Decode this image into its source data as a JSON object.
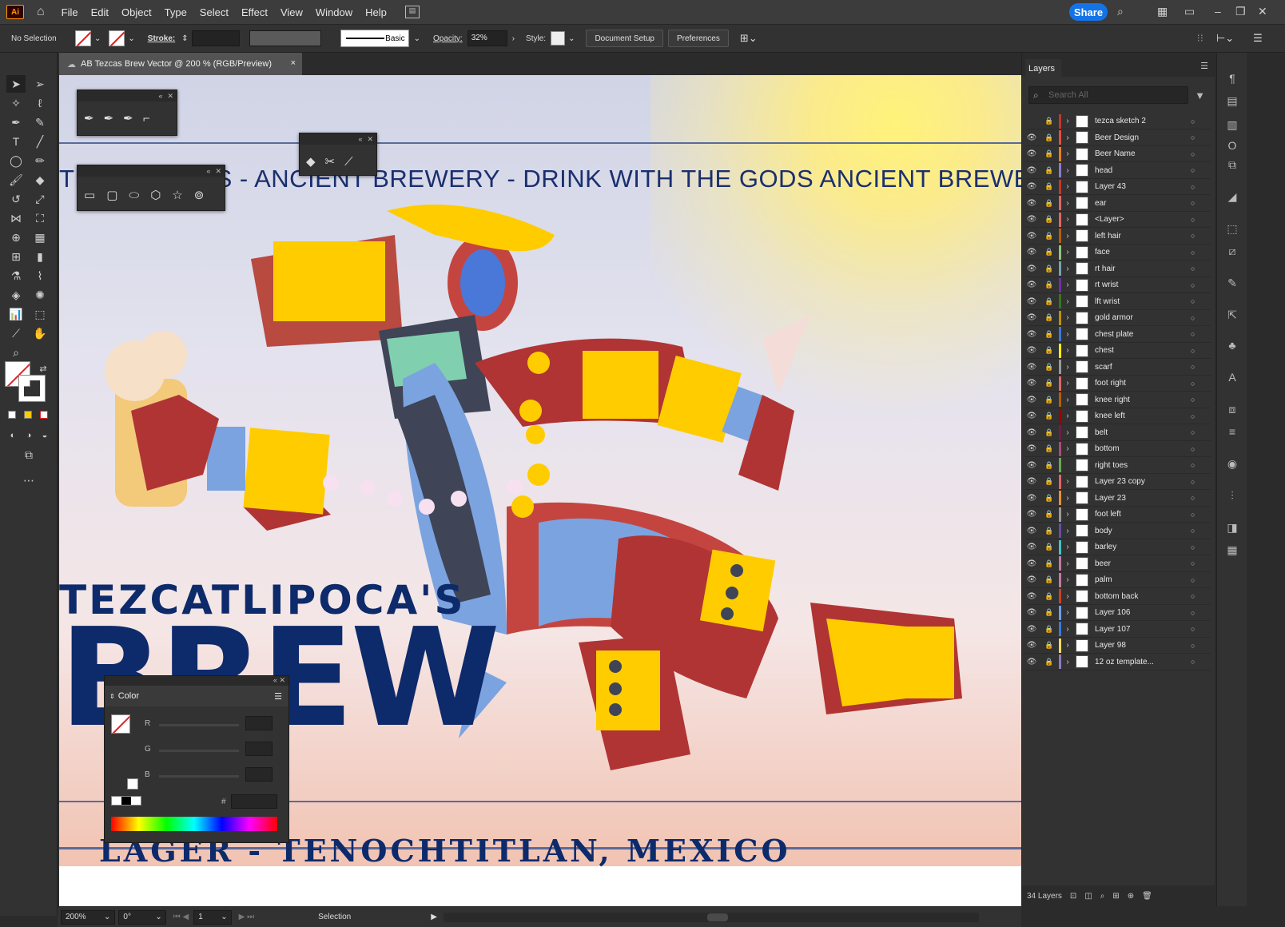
{
  "app": {
    "logo": "Ai"
  },
  "menu": [
    "File",
    "Edit",
    "Object",
    "Type",
    "Select",
    "Effect",
    "View",
    "Window",
    "Help"
  ],
  "share_label": "Share",
  "control": {
    "selection": "No Selection",
    "stroke_label": "Stroke:",
    "stroke_style": "Basic",
    "opacity_label": "Opacity:",
    "opacity_value": "32%",
    "style_label": "Style:",
    "document_setup": "Document Setup",
    "preferences": "Preferences"
  },
  "document_tab": {
    "title": "AB Tezcas Brew Vector @ 200 % (RGB/Preview)",
    "close": "×"
  },
  "artwork": {
    "band_text": "TH THE GODS - ANCIENT BREWERY - DRINK WITH THE GODS   ANCIENT BREWERY - DRINK WI",
    "title_line1": "TEZCATLIPOCA'S",
    "title_line2": "BREW",
    "subline": "LAGER - TENOCHTITLAN, MEXICO",
    "colors": {
      "navy": "#0d2a6b",
      "red": "#b03434",
      "yellow": "#ffcc00",
      "blue": "#7ba3e0"
    }
  },
  "color_panel": {
    "title": "Color",
    "r": "R",
    "g": "G",
    "b": "B",
    "hash": "#"
  },
  "layers_panel": {
    "title": "Layers",
    "search_placeholder": "Search All",
    "count_label": "34 Layers",
    "layers": [
      {
        "name": "tezca sketch 2",
        "color": "#c0392b"
      },
      {
        "name": "Beer Design",
        "color": "#e74c3c"
      },
      {
        "name": "Beer Name",
        "color": "#e67e22"
      },
      {
        "name": "head",
        "color": "#8e7cc3"
      },
      {
        "name": "Layer 43",
        "color": "#c0392b"
      },
      {
        "name": "ear",
        "color": "#e06666"
      },
      {
        "name": "<Layer>",
        "color": "#e06666"
      },
      {
        "name": "left hair",
        "color": "#b45f06"
      },
      {
        "name": "face",
        "color": "#93c47d"
      },
      {
        "name": "rt hair",
        "color": "#76a5af"
      },
      {
        "name": "rt wrist",
        "color": "#7030a0"
      },
      {
        "name": "lft wrist",
        "color": "#38761d"
      },
      {
        "name": "gold armor",
        "color": "#bf9000"
      },
      {
        "name": "chest plate",
        "color": "#3c78d8"
      },
      {
        "name": "chest",
        "color": "#ffff00"
      },
      {
        "name": "scarf",
        "color": "#999999"
      },
      {
        "name": "foot right",
        "color": "#e06666"
      },
      {
        "name": "knee right",
        "color": "#b45f06"
      },
      {
        "name": "knee left",
        "color": "#990000"
      },
      {
        "name": "belt",
        "color": "#741b47"
      },
      {
        "name": "bottom",
        "color": "#a64d79"
      },
      {
        "name": "right toes",
        "color": "#6aa84f"
      },
      {
        "name": "Layer 23 copy",
        "color": "#e06666"
      },
      {
        "name": "Layer 23",
        "color": "#e69138"
      },
      {
        "name": "foot left",
        "color": "#999999"
      },
      {
        "name": "body",
        "color": "#674ea7"
      },
      {
        "name": "barley",
        "color": "#45c4c4"
      },
      {
        "name": "beer",
        "color": "#c27ba0"
      },
      {
        "name": "palm",
        "color": "#c27ba0"
      },
      {
        "name": "bottom back",
        "color": "#cc4125"
      },
      {
        "name": "Layer 106",
        "color": "#6d9eeb"
      },
      {
        "name": "Layer 107",
        "color": "#3c78d8"
      },
      {
        "name": "Layer 98",
        "color": "#ffd966"
      },
      {
        "name": "12 oz template...",
        "color": "#8e7cc3"
      }
    ]
  },
  "status": {
    "zoom": "200%",
    "rotation": "0°",
    "artboard": "1",
    "mode": "Selection"
  }
}
